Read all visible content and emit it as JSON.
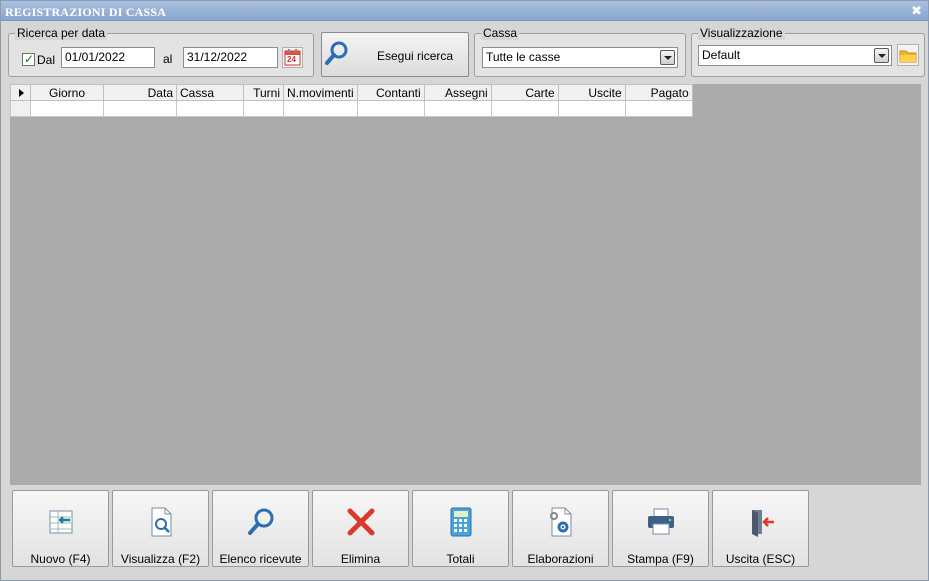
{
  "window": {
    "title": "REGISTRAZIONI DI CASSA",
    "close_glyph": "✖"
  },
  "date_search": {
    "group_label": "Ricerca per data",
    "from_checkbox_label": "Dal",
    "from_checked": true,
    "from_date": "01/01/2022",
    "to_label": "al",
    "to_date": "31/12/2022",
    "calendar_day": "24"
  },
  "search": {
    "button_label": "Esegui ricerca"
  },
  "cassa": {
    "group_label": "Cassa",
    "selected": "Tutte le casse"
  },
  "view": {
    "group_label": "Visualizzazione",
    "selected": "Default"
  },
  "grid": {
    "columns": [
      "Giorno",
      "Data",
      "Cassa",
      "Turni",
      "N.movimenti",
      "Contanti",
      "Assegni",
      "Carte",
      "Uscite",
      "Pagato"
    ],
    "rows": [
      [
        "",
        "",
        "",
        "",
        "",
        "",
        "",
        "",
        "",
        ""
      ]
    ]
  },
  "toolbar": {
    "buttons": [
      {
        "label": "Nuovo (F4)",
        "icon": "new-record-icon"
      },
      {
        "label": "Visualizza (F2)",
        "icon": "view-document-icon"
      },
      {
        "label": "Elenco ricevute",
        "icon": "search-icon"
      },
      {
        "label": "Elimina",
        "icon": "delete-icon"
      },
      {
        "label": "Totali",
        "icon": "calculator-icon"
      },
      {
        "label": "Elaborazioni",
        "icon": "process-document-icon"
      },
      {
        "label": "Stampa (F9)",
        "icon": "printer-icon"
      },
      {
        "label": "Uscita (ESC)",
        "icon": "exit-door-icon"
      }
    ]
  },
  "colors": {
    "title_bar": "#8aa6cc",
    "grid_background": "#ababab",
    "delete_red": "#d93a2a",
    "accent_blue": "#2d6db3"
  }
}
